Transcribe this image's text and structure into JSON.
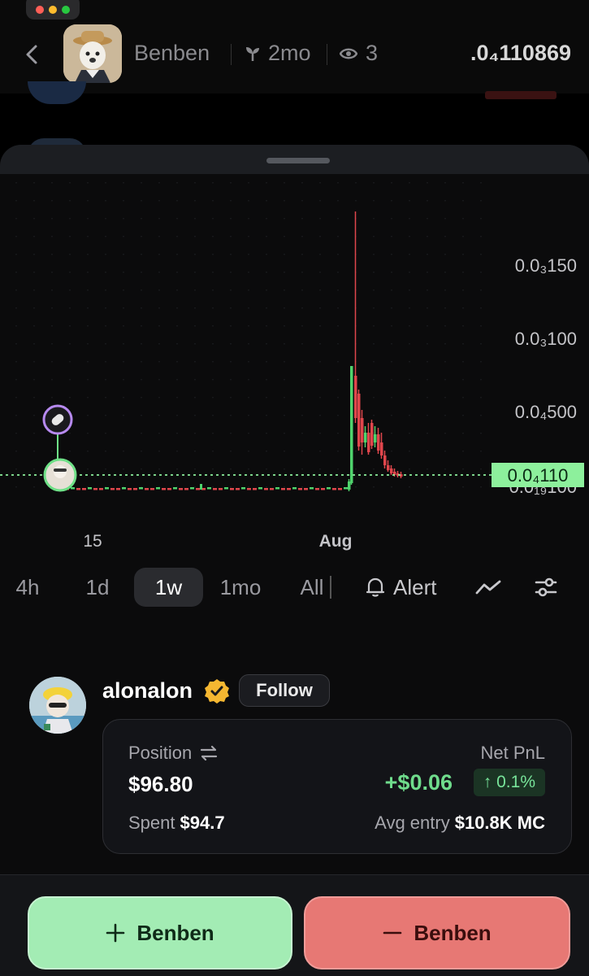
{
  "header": {
    "token_name": "Benben",
    "age": "2mo",
    "views": "3",
    "price": ".0₄110869"
  },
  "chart_data": {
    "type": "candlestick",
    "title": "",
    "x_ticks": [
      "15",
      "Aug"
    ],
    "y_ticks": [
      "0.0₃150",
      "0.0₃100",
      "0.0₄500",
      "0.0₁₉100"
    ],
    "current_price_label": "0.0₄110",
    "current_price": 1.1e-05,
    "current_price_color": "#8df09c",
    "up_color": "#4fd36c",
    "down_color": "#e0464c",
    "grid": "dotted",
    "series": [
      {
        "name": "",
        "values": [
          1e-06,
          1e-06,
          1e-06,
          1e-06,
          1e-06,
          1e-06,
          1.2e-06,
          8.5e-05,
          0.00019,
          4.5e-05,
          4e-05,
          4.3e-05,
          3.8e-05,
          3.6e-05,
          2e-05,
          1.2e-05,
          1.1e-05
        ]
      }
    ]
  },
  "timeframes": {
    "items": [
      "4h",
      "1d",
      "1w",
      "1mo",
      "All"
    ],
    "active": "1w",
    "alert_label": "Alert"
  },
  "trader": {
    "name": "alonalon",
    "follow_label": "Follow",
    "position_label": "Position",
    "position_value": "$96.80",
    "spent_label": "Spent",
    "spent_value": "$94.7",
    "pnl_label": "Net PnL",
    "pnl_value": "+$0.06",
    "pnl_pct": "↑ 0.1%",
    "avg_entry_label": "Avg entry",
    "avg_entry_value": "$10.8K MC"
  },
  "actions": {
    "buy_label": "Benben",
    "sell_label": "Benben",
    "buy_color": "#a3ecb4",
    "sell_color": "#e77874"
  }
}
